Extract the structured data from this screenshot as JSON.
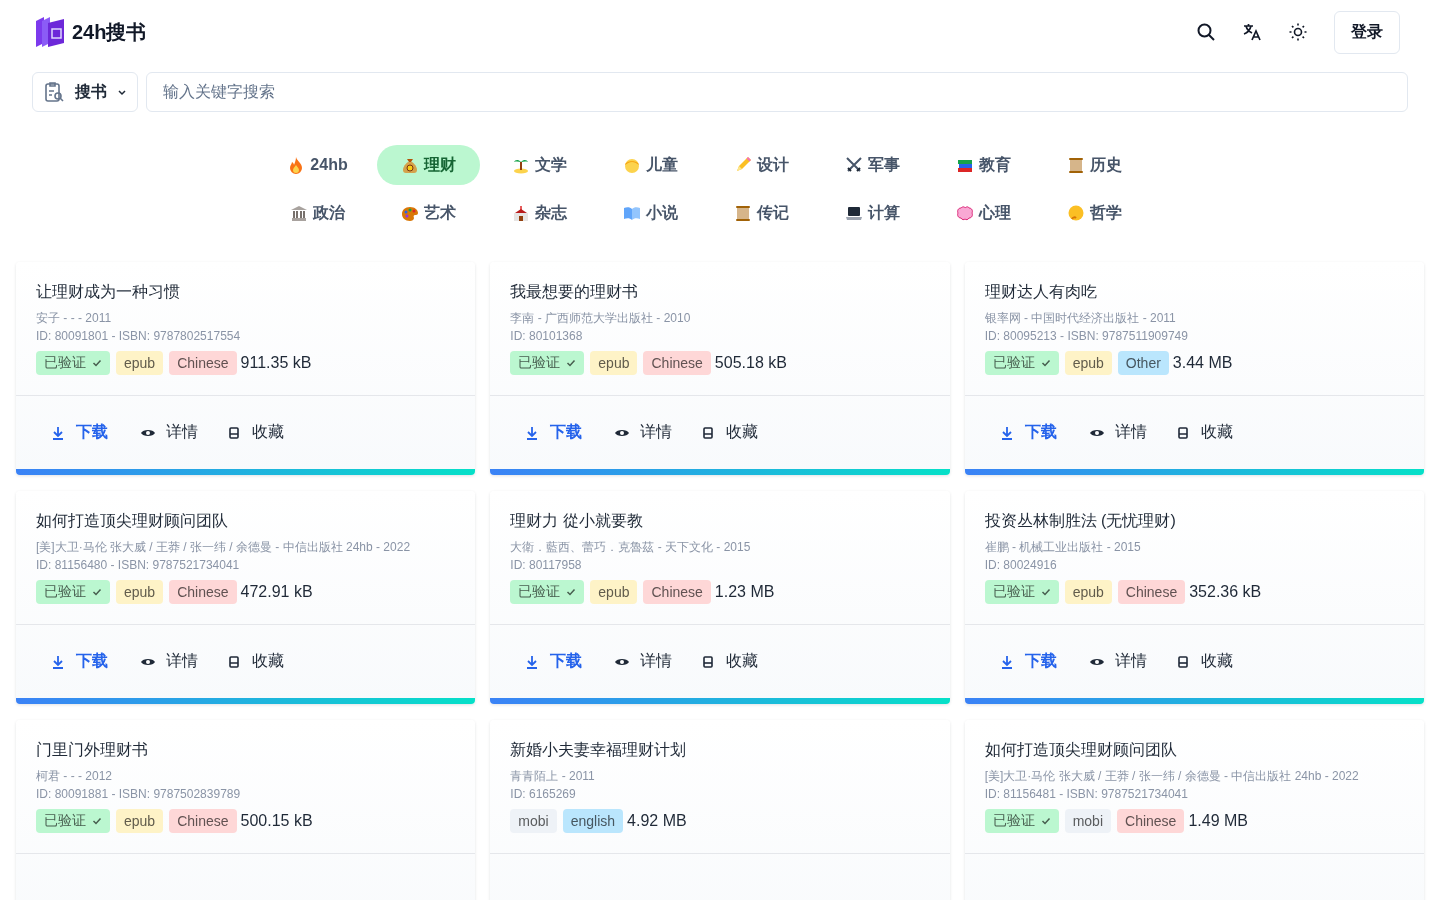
{
  "header": {
    "logo_text": "24h搜书",
    "login_button": "登录"
  },
  "search": {
    "scope": "搜书",
    "placeholder": "输入关键字搜索"
  },
  "categories": [
    {
      "label": "24hb",
      "selected": false
    },
    {
      "label": "理财",
      "selected": true
    },
    {
      "label": "文学",
      "selected": false
    },
    {
      "label": "儿童",
      "selected": false
    },
    {
      "label": "设计",
      "selected": false
    },
    {
      "label": "军事",
      "selected": false
    },
    {
      "label": "教育",
      "selected": false
    },
    {
      "label": "历史",
      "selected": false
    },
    {
      "label": "政治",
      "selected": false
    },
    {
      "label": "艺术",
      "selected": false
    },
    {
      "label": "杂志",
      "selected": false
    },
    {
      "label": "小说",
      "selected": false
    },
    {
      "label": "传记",
      "selected": false
    },
    {
      "label": "计算",
      "selected": false
    },
    {
      "label": "心理",
      "selected": false
    },
    {
      "label": "哲学",
      "selected": false
    }
  ],
  "books": [
    {
      "title": "让理财成为一种习惯",
      "meta": "安子 - - - 2011",
      "ids": "ID: 80091801 - ISBN: 9787802517554",
      "tags": [
        {
          "kind": "verified",
          "label": "已验证",
          "color": "#bbf7d0"
        },
        {
          "kind": "format",
          "label": "epub",
          "color": "#fef3c7"
        },
        {
          "kind": "language",
          "label": "Chinese",
          "color": "#fed7d7"
        }
      ],
      "size": "911.35 kB",
      "actions": [
        {
          "kind": "download",
          "label": "下载"
        },
        {
          "kind": "details",
          "label": "详情"
        },
        {
          "kind": "bookmark",
          "label": "收藏"
        }
      ]
    },
    {
      "title": "我最想要的理财书",
      "meta": "李南 - 广西师范大学出版社 - 2010",
      "ids": "ID: 80101368",
      "tags": [
        {
          "kind": "verified",
          "label": "已验证",
          "color": "#bbf7d0"
        },
        {
          "kind": "format",
          "label": "epub",
          "color": "#fef3c7"
        },
        {
          "kind": "language",
          "label": "Chinese",
          "color": "#fed7d7"
        }
      ],
      "size": "505.18 kB",
      "actions": [
        {
          "kind": "download",
          "label": "下载"
        },
        {
          "kind": "details",
          "label": "详情"
        },
        {
          "kind": "bookmark",
          "label": "收藏"
        }
      ]
    },
    {
      "title": "理财达人有肉吃",
      "meta": "银率网 - 中国时代经济出版社 - 2011",
      "ids": "ID: 80095213 - ISBN: 9787511909749",
      "tags": [
        {
          "kind": "verified",
          "label": "已验证",
          "color": "#bbf7d0"
        },
        {
          "kind": "format",
          "label": "epub",
          "color": "#fef3c7"
        },
        {
          "kind": "language",
          "label": "Other",
          "color": "#bae6fd"
        }
      ],
      "size": "3.44 MB",
      "actions": [
        {
          "kind": "download",
          "label": "下载"
        },
        {
          "kind": "details",
          "label": "详情"
        },
        {
          "kind": "bookmark",
          "label": "收藏"
        }
      ]
    },
    {
      "title": "如何打造顶尖理财顾问团队",
      "meta": "[美]大卫·马伦 张大威 / 王莽 / 张一纬 / 余德曼 - 中信出版社 24hb - 2022",
      "ids": "ID: 81156480 - ISBN: 9787521734041",
      "tags": [
        {
          "kind": "verified",
          "label": "已验证",
          "color": "#bbf7d0"
        },
        {
          "kind": "format",
          "label": "epub",
          "color": "#fef3c7"
        },
        {
          "kind": "language",
          "label": "Chinese",
          "color": "#fed7d7"
        }
      ],
      "size": "472.91 kB",
      "actions": [
        {
          "kind": "download",
          "label": "下载"
        },
        {
          "kind": "details",
          "label": "详情"
        },
        {
          "kind": "bookmark",
          "label": "收藏"
        }
      ]
    },
    {
      "title": "理财力 從小就要教",
      "meta": "大衛．藍西、蕾巧．克魯茲 - 天下文化 - 2015",
      "ids": "ID: 80117958",
      "tags": [
        {
          "kind": "verified",
          "label": "已验证",
          "color": "#bbf7d0"
        },
        {
          "kind": "format",
          "label": "epub",
          "color": "#fef3c7"
        },
        {
          "kind": "language",
          "label": "Chinese",
          "color": "#fed7d7"
        }
      ],
      "size": "1.23 MB",
      "actions": [
        {
          "kind": "download",
          "label": "下载"
        },
        {
          "kind": "details",
          "label": "详情"
        },
        {
          "kind": "bookmark",
          "label": "收藏"
        }
      ]
    },
    {
      "title": "投资丛林制胜法 (无忧理财)",
      "meta": "崔鹏 - 机械工业出版社 - 2015",
      "ids": "ID: 80024916",
      "tags": [
        {
          "kind": "verified",
          "label": "已验证",
          "color": "#bbf7d0"
        },
        {
          "kind": "format",
          "label": "epub",
          "color": "#fef3c7"
        },
        {
          "kind": "language",
          "label": "Chinese",
          "color": "#fed7d7"
        }
      ],
      "size": "352.36 kB",
      "actions": [
        {
          "kind": "download",
          "label": "下载"
        },
        {
          "kind": "details",
          "label": "详情"
        },
        {
          "kind": "bookmark",
          "label": "收藏"
        }
      ]
    },
    {
      "title": "门里门外理财书",
      "meta": "柯君 - - - 2012",
      "ids": "ID: 80091881 - ISBN: 9787502839789",
      "tags": [
        {
          "kind": "verified",
          "label": "已验证",
          "color": "#bbf7d0"
        },
        {
          "kind": "format",
          "label": "epub",
          "color": "#fef3c7"
        },
        {
          "kind": "language",
          "label": "Chinese",
          "color": "#fed7d7"
        }
      ],
      "size": "500.15 kB"
    },
    {
      "title": "新婚小夫妻幸福理财计划",
      "meta": "青青陌上 - 2011",
      "ids": "ID: 6165269",
      "tags": [
        {
          "kind": "format",
          "label": "mobi",
          "color": "#eef2f7"
        },
        {
          "kind": "language",
          "label": "english",
          "color": "#bae6fd"
        }
      ],
      "size": "4.92 MB"
    },
    {
      "title": "如何打造顶尖理财顾问团队",
      "meta": "[美]大卫·马伦 张大威 / 王莽 / 张一纬 / 余德曼 - 中信出版社 24hb - 2022",
      "ids": "ID: 81156481 - ISBN: 9787521734041",
      "tags": [
        {
          "kind": "verified",
          "label": "已验证",
          "color": "#bbf7d0"
        },
        {
          "kind": "format",
          "label": "mobi",
          "color": "#eef2f7"
        },
        {
          "kind": "language",
          "label": "Chinese",
          "color": "#fed7d7"
        }
      ],
      "size": "1.49 MB"
    }
  ]
}
